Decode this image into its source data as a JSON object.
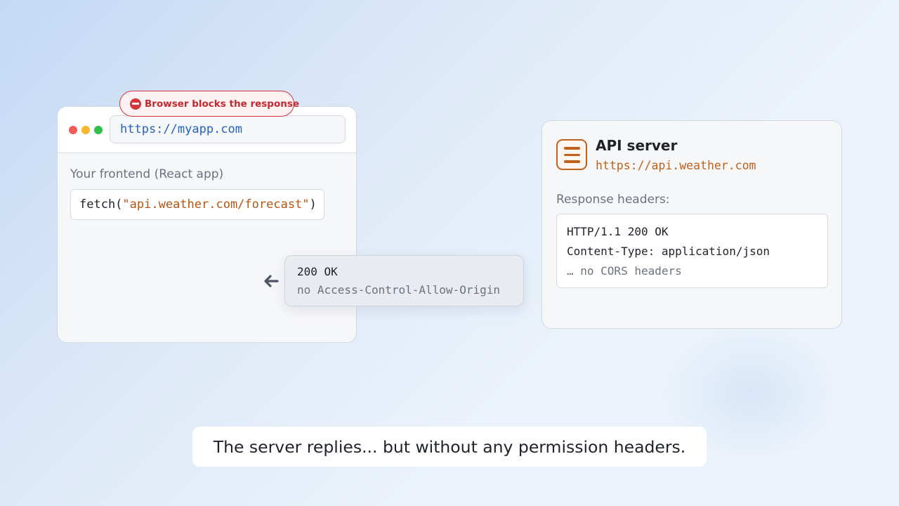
{
  "browser": {
    "url": "https://myapp.com",
    "frontend_label": "Your frontend (React app)",
    "fetch_prefix": "fetch(",
    "fetch_arg": "\"api.weather.com/forecast\"",
    "fetch_suffix": ")"
  },
  "badge": {
    "icon": "no-entry-icon",
    "text": "Browser blocks the response"
  },
  "response": {
    "arrow_icon": "arrow-left-icon",
    "status": "200 OK",
    "note": "no Access-Control-Allow-Origin"
  },
  "server": {
    "icon": "server-icon",
    "title": "API server",
    "url": "https://api.weather.com",
    "headers_label": "Response headers:",
    "headers": [
      "HTTP/1.1 200 OK",
      "Content-Type: application/json",
      "… no CORS headers"
    ]
  },
  "caption": "The server replies... but without any permission headers.",
  "colors": {
    "window_red": "#f25c56",
    "window_yellow": "#f5b82e",
    "window_green": "#2fbf4a",
    "link_blue": "#2462c8",
    "string_orange": "#b8530f",
    "server_accent": "#c0601a",
    "blocked_red": "#d6343b"
  }
}
